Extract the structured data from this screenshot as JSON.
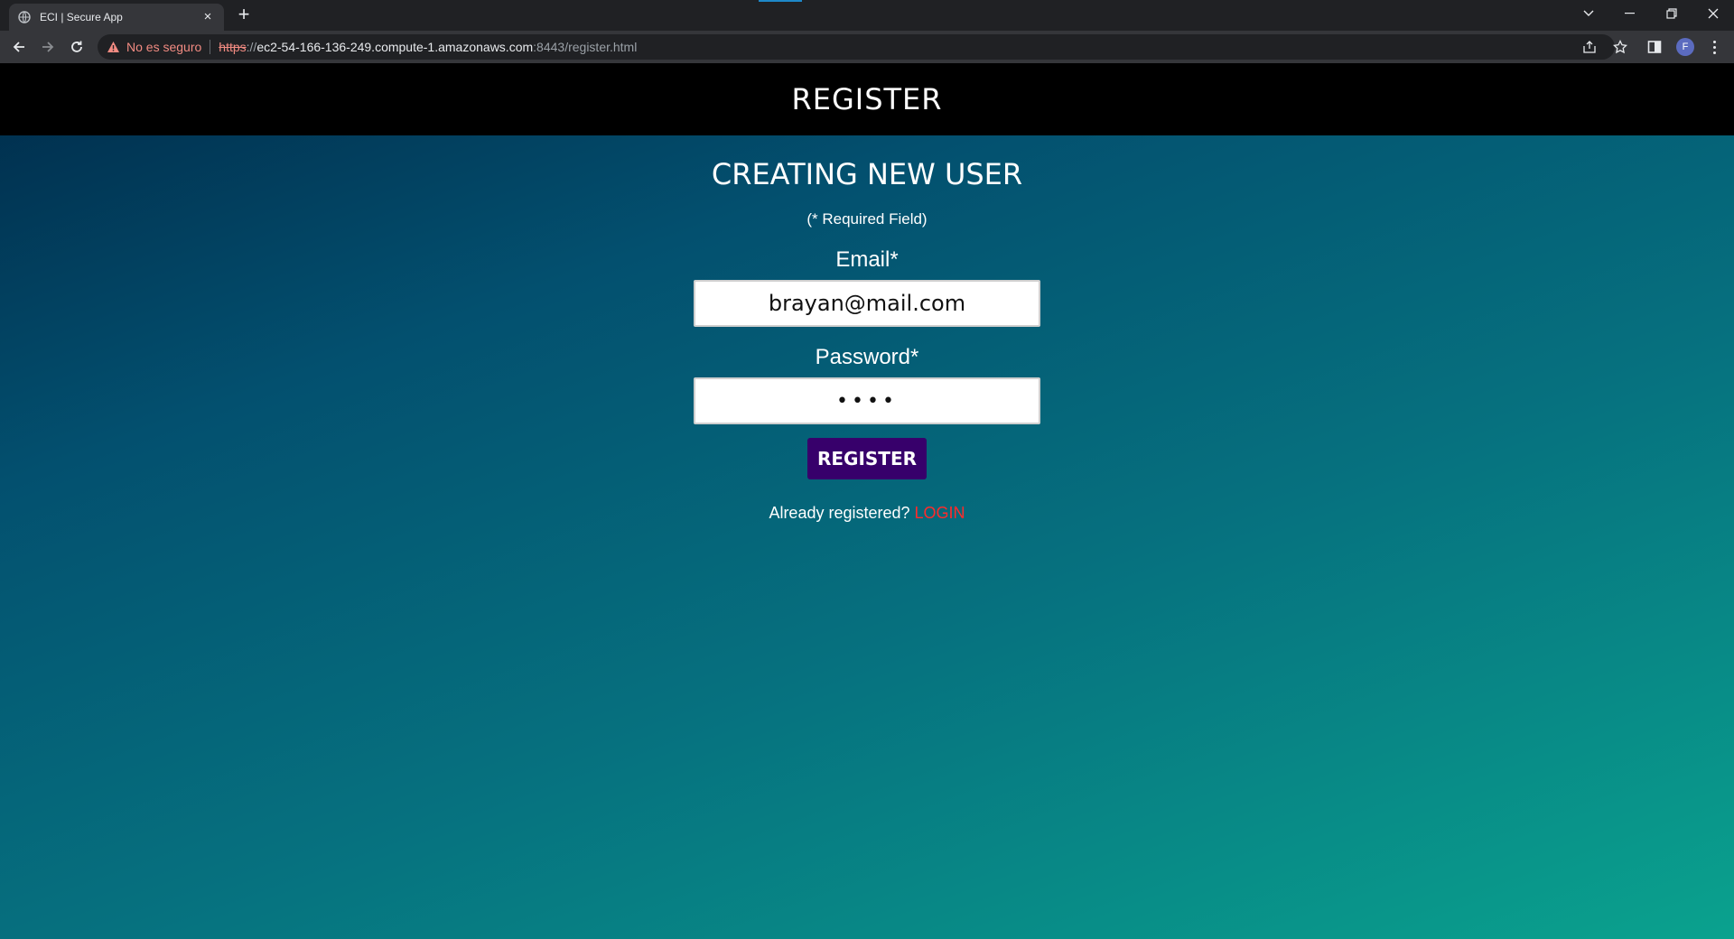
{
  "browser": {
    "tab_title": "ECI | Secure App",
    "tab_close": "×",
    "new_tab": "+",
    "security_warning": "No es seguro",
    "url_scheme": "https",
    "url_separator": "://",
    "url_host": "ec2-54-166-136-249.compute-1.amazonaws.com",
    "url_rest": ":8443/register.html",
    "profile_initial": "F"
  },
  "page": {
    "header_title": "REGISTER",
    "form_title": "CREATING NEW USER",
    "required_note": "(* Required Field)",
    "email_label": "Email*",
    "email_value": "brayan@mail.com",
    "password_label": "Password*",
    "password_value": "••••",
    "register_button": "REGISTER",
    "already_registered": "Already registered?",
    "login_link": "LOGIN"
  },
  "colors": {
    "header_bg": "#000000",
    "button_bg": "#37006b",
    "login_link": "#ff2b2b",
    "gradient_start": "#002b4a",
    "gradient_end": "#0aa28e"
  }
}
